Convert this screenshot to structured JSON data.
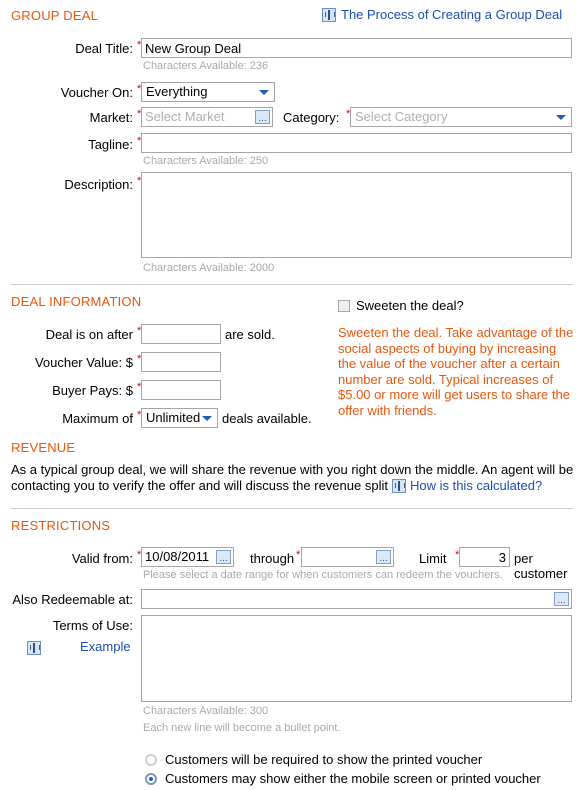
{
  "sections": {
    "group_deal": {
      "title": "GROUP DEAL",
      "process_link": "The Process of Creating a Group Deal",
      "process_icon": "help-badge-icon",
      "fields": {
        "deal_title": {
          "label": "Deal Title:",
          "required": "*",
          "value": "New Group Deal",
          "hint": "Characters Available: 236"
        },
        "voucher_on": {
          "label": "Voucher On:",
          "required": "*",
          "value": "Everything"
        },
        "market": {
          "label": "Market:",
          "required": "*",
          "placeholder": "Select Market",
          "value": "",
          "picker_label": "..."
        },
        "category": {
          "label": "Category:",
          "required": "*",
          "value": "Select Category"
        },
        "tagline": {
          "label": "Tagline:",
          "required": "*",
          "value": "",
          "hint": "Characters Available: 250"
        },
        "description": {
          "label": "Description:",
          "required": "*",
          "value": "",
          "hint": "Characters Available: 2000"
        }
      }
    },
    "deal_information": {
      "title": "DEAL INFORMATION",
      "sweeten_checkbox_label": "Sweeten the deal?",
      "sweeten_note": "Sweeten the deal. Take advantage of the social aspects of buying by increasing the value of the voucher after a certain number are sold. Typical increases of $5.00 or more will get users to share the offer with friends.",
      "fields": {
        "deal_is_on_after": {
          "label": "Deal is on after",
          "required": "*",
          "value": "",
          "suffix": "are sold."
        },
        "voucher_value": {
          "label": "Voucher Value: $",
          "required": "*",
          "value": ""
        },
        "buyer_pays": {
          "label": "Buyer Pays: $",
          "required": "*",
          "value": ""
        },
        "maximum_of": {
          "label": "Maximum of",
          "required": "*",
          "value": "Unlimited",
          "suffix": "deals available."
        }
      }
    },
    "revenue": {
      "title": "REVENUE",
      "body": "As a typical group deal, we will share the revenue with you right down the middle. An agent will be contacting you to verify the offer and will discuss the revenue split",
      "calc_link": "How is this calculated?",
      "calc_icon": "help-badge-icon"
    },
    "restrictions": {
      "title": "RESTRICTIONS",
      "fields": {
        "valid_from": {
          "label": "Valid from:",
          "required": "*",
          "value": "10/08/2011",
          "picker_label": "..."
        },
        "through": {
          "label": "through",
          "required": "*",
          "value": "",
          "picker_label": "..."
        },
        "limit": {
          "label": "Limit",
          "required": "*",
          "value": "3",
          "suffix": "per customer"
        },
        "date_hint": "Please select a date range for when customers can redeem the vouchers.",
        "also_redeemable": {
          "label": "Also Redeemable at:",
          "value": "",
          "picker_label": "..."
        },
        "terms_of_use": {
          "label": "Terms of Use:",
          "example_link": "Example",
          "example_icon": "help-badge-icon",
          "value": "",
          "hint": "Characters Available: 300",
          "hint2": "Each new line will become a bullet point."
        }
      },
      "voucher_options": [
        {
          "label": "Customers will be required to show the printed voucher",
          "selected": false
        },
        {
          "label": "Customers may show either the mobile screen or printed voucher",
          "selected": true
        }
      ]
    }
  },
  "colors": {
    "section_heading": "#E8570E",
    "link": "#1A4FB4",
    "required_asterisk": "#E00000",
    "hint_text": "#A9A9A9"
  }
}
